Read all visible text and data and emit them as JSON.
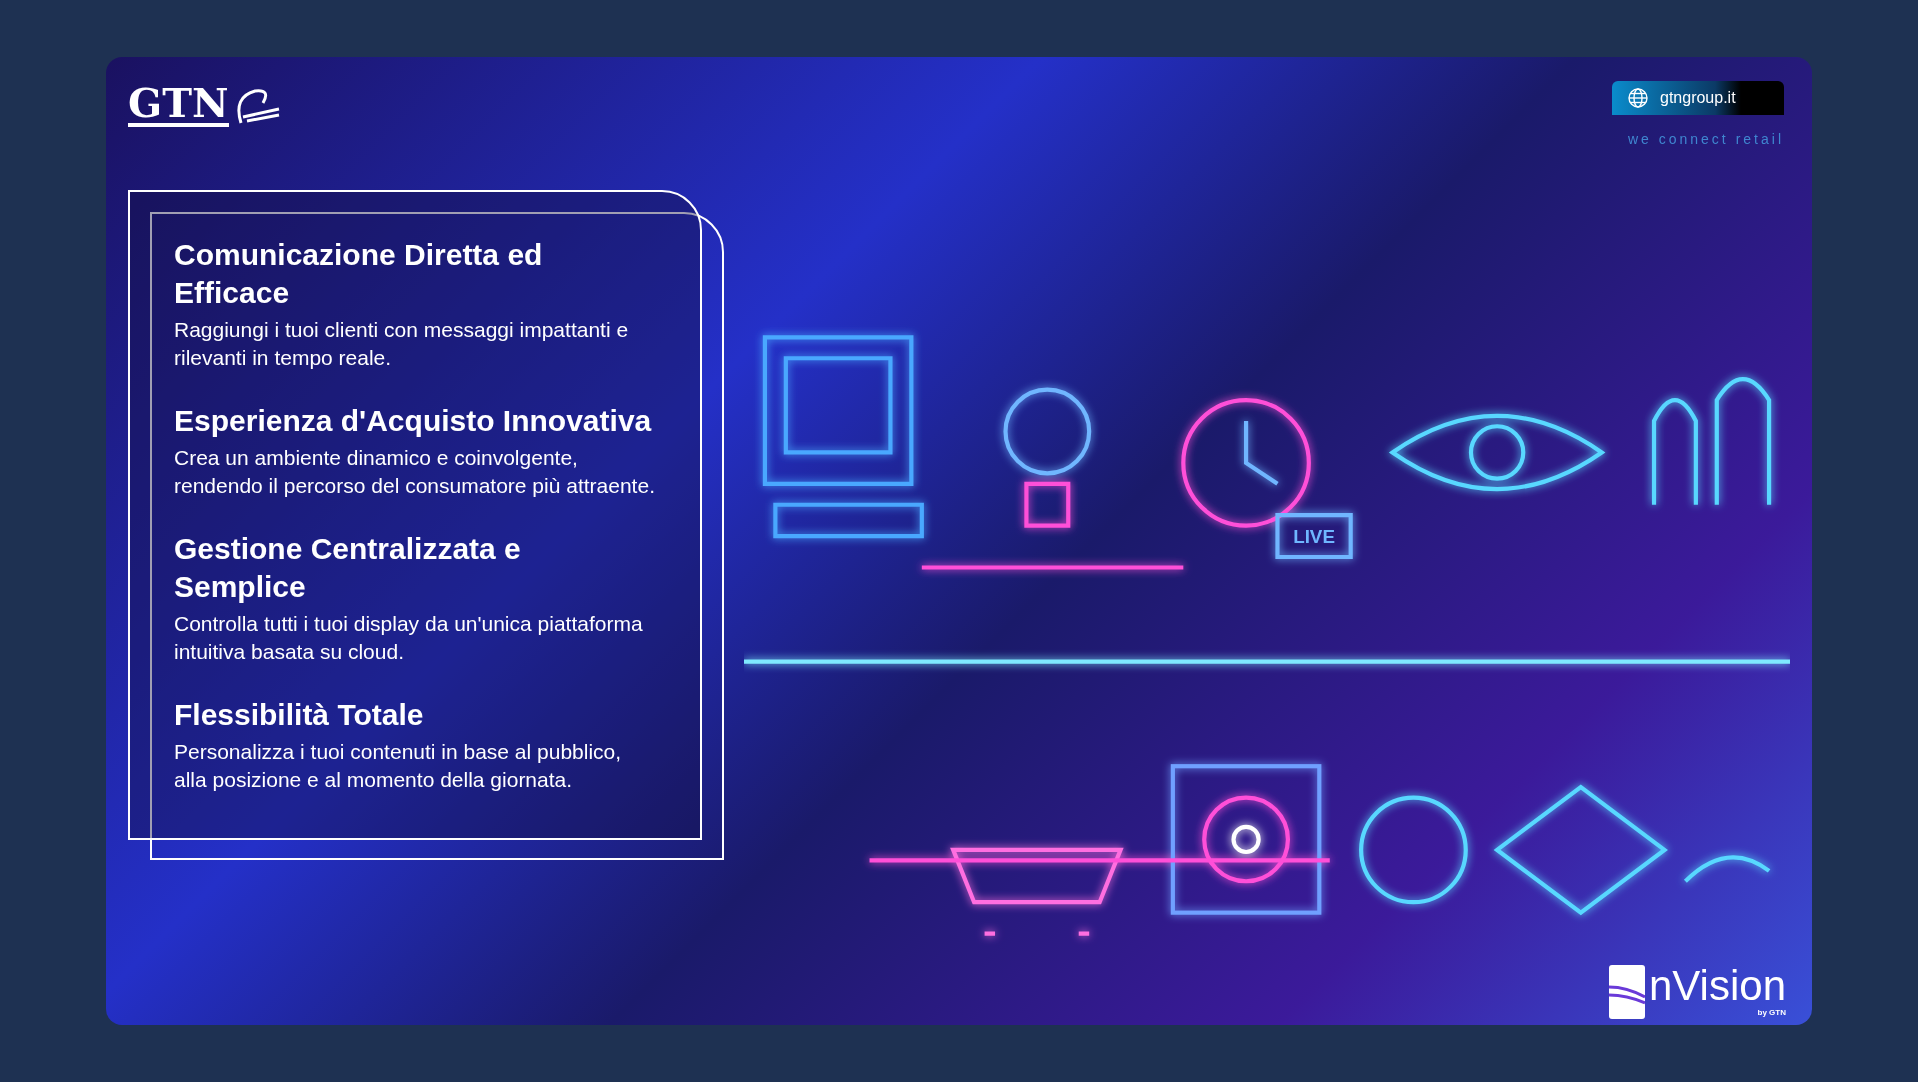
{
  "header": {
    "logo": {
      "text": "GTN"
    },
    "website": "gtngroup.it",
    "tagline": "we connect retail"
  },
  "features": [
    {
      "title": "Comunicazione Diretta ed Efficace",
      "text": "Raggiungi i tuoi clienti con messaggi impattanti e rilevanti in tempo reale."
    },
    {
      "title": "Esperienza d'Acquisto Innovativa",
      "text": "Crea un ambiente dinamico e coinvolgente, rendendo il percorso del consumatore più attraente."
    },
    {
      "title": "Gestione Centralizzata e Semplice",
      "text": "Controlla tutti i tuoi display da un'unica piattaforma intuitiva basata su cloud."
    },
    {
      "title": "Flessibilità Totale",
      "text": "Personalizza i tuoi contenuti in base al pubblico, alla posizione e al momento della giornata."
    }
  ],
  "artwork": {
    "badge": "LIVE"
  },
  "brand": {
    "name": "nVision",
    "byline": "by GTN"
  }
}
